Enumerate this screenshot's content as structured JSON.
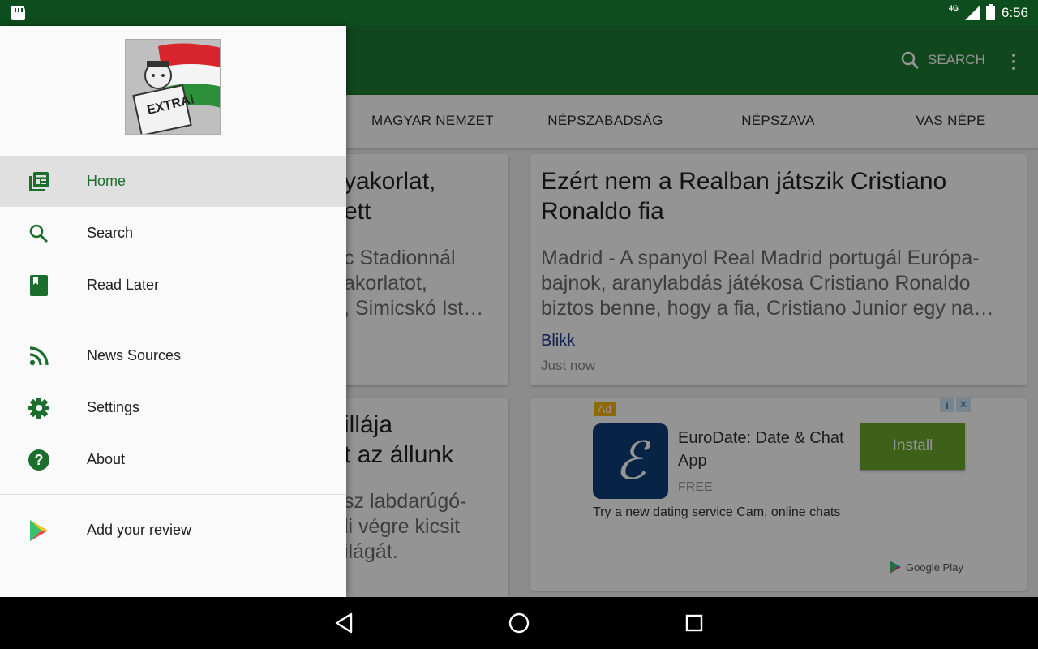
{
  "status_bar": {
    "network": "4G",
    "time": "6:56"
  },
  "toolbar": {
    "search_label": "SEARCH"
  },
  "tabs": [
    "MAGYAR NEMZET",
    "NÉPSZABADSÁG",
    "NÉPSZAVA",
    "VAS NÉPE"
  ],
  "cards": [
    {
      "title_lines": [
        "yakorlat,",
        "ett"
      ],
      "body_lines": [
        "c Stadionnál",
        "akorlatot,",
        ", Simicskó Ist…"
      ]
    },
    {
      "title_lines": [
        "Ezért nem a Realban játszik Cristiano",
        "Ronaldo fia"
      ],
      "body_lines": [
        "Madrid - A spanyol Real Madrid portugál Európa-",
        "bajnok, aranylabdás játékosa Cristiano Ronaldo",
        "biztos benne, hogy a fia, Cristiano Junior egy na…"
      ],
      "source": "Blikk",
      "time": "Just now"
    },
    {
      "title_lines": [
        "illája",
        "t az állunk"
      ],
      "body_lines": [
        "sz labdarúgó-",
        "li végre kicsit",
        "ilágát."
      ]
    }
  ],
  "ad": {
    "badge": "Ad",
    "info": "i",
    "close": "✕",
    "logo_glyph": "ℰ",
    "title_lines": [
      "EuroDate: Date & Chat",
      "App"
    ],
    "price": "FREE",
    "install": "Install",
    "description": "Try a new dating service Cam, online chats",
    "store": "Google Play"
  },
  "drawer": {
    "logo_text": "EXTRA!",
    "items": [
      {
        "label": "Home",
        "icon": "newspaper-icon",
        "active": true
      },
      {
        "label": "Search",
        "icon": "search-icon"
      },
      {
        "label": "Read Later",
        "icon": "bookmark-icon"
      },
      {
        "label": "News Sources",
        "icon": "rss-icon"
      },
      {
        "label": "Settings",
        "icon": "gear-icon"
      },
      {
        "label": "About",
        "icon": "help-icon"
      },
      {
        "label": "Add your review",
        "icon": "play-store-icon"
      }
    ]
  },
  "colors": {
    "primary": "#1c7a32",
    "primary_dark": "#0e4d1d",
    "accent_green": "#1b6e2c",
    "install_button": "#69a72a"
  }
}
